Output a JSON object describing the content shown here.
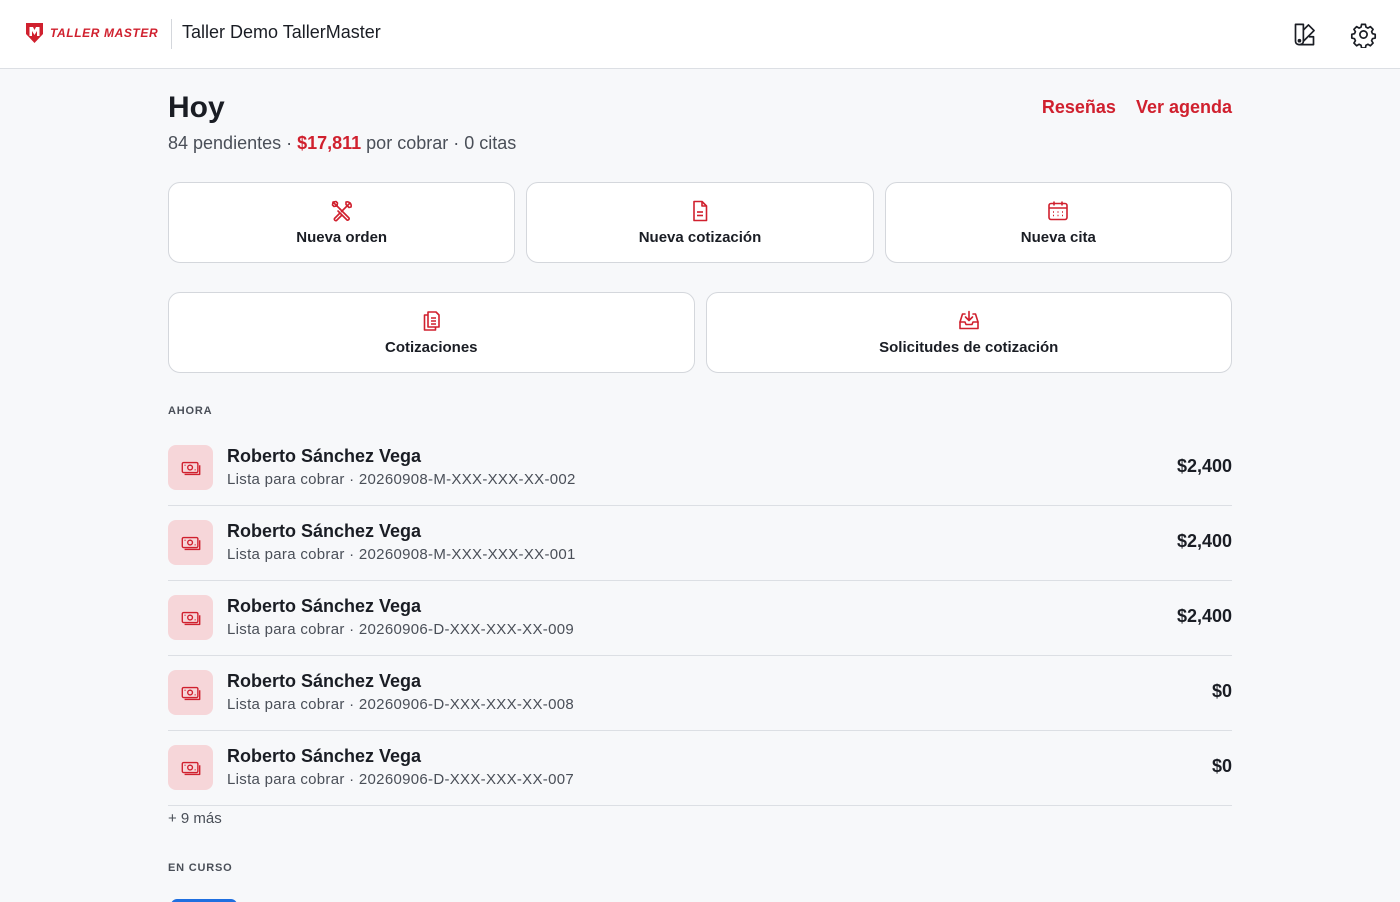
{
  "brand": {
    "logo_text": "TALLER MASTER",
    "accent": "#d0202e"
  },
  "topbar": {
    "shop_name": "Taller Demo TallerMaster"
  },
  "header": {
    "title": "Hoy",
    "summary_pending": "84 pendientes · ",
    "summary_money": "$17,811",
    "summary_rest": " por cobrar · 0 citas",
    "links": [
      "Reseñas",
      "Ver agenda"
    ]
  },
  "actions": {
    "new_order": "Nueva orden",
    "new_quote": "Nueva cotización",
    "new_appointment": "Nueva cita",
    "quotes": "Cotizaciones",
    "quote_requests": "Solicitudes de cotización"
  },
  "sections": {
    "now": "AHORA",
    "in_progress": "EN CURSO"
  },
  "now_list": [
    {
      "name": "Roberto Sánchez Vega",
      "sub": "Lista para cobrar · 20260908-M-XXX-XXX-XX-002",
      "amount": "$2,400"
    },
    {
      "name": "Roberto Sánchez Vega",
      "sub": "Lista para cobrar · 20260908-M-XXX-XXX-XX-001",
      "amount": "$2,400"
    },
    {
      "name": "Roberto Sánchez Vega",
      "sub": "Lista para cobrar · 20260906-D-XXX-XXX-XX-009",
      "amount": "$2,400"
    },
    {
      "name": "Roberto Sánchez Vega",
      "sub": "Lista para cobrar · 20260906-D-XXX-XXX-XX-008",
      "amount": "$0"
    },
    {
      "name": "Roberto Sánchez Vega",
      "sub": "Lista para cobrar · 20260906-D-XXX-XXX-XX-007",
      "amount": "$0"
    }
  ],
  "more_label": "+ 9 más"
}
